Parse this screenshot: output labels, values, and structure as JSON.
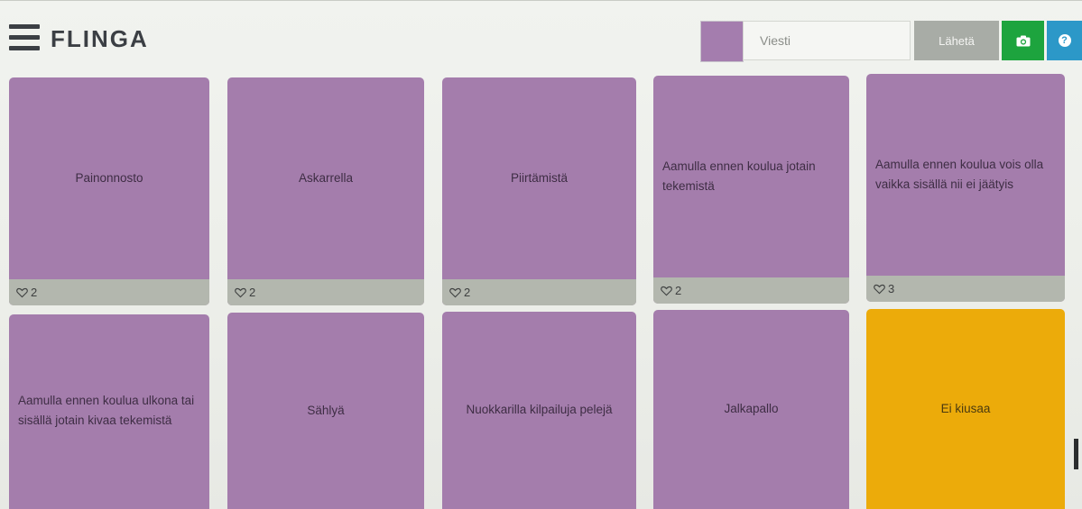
{
  "header": {
    "brand": "FLINGA",
    "swatch_color": "#a47dae",
    "message_placeholder": "Viesti",
    "send_label": "Lähetä",
    "camera_icon": "camera-icon",
    "help_icon": "help-icon",
    "help_glyph": "?"
  },
  "colors": {
    "card_purple": "#a47dac",
    "card_yellow": "#ecab0a",
    "footer_gray": "#b3b7ae",
    "camera_green": "#1da43e",
    "help_blue": "#2c98c8"
  },
  "cards": [
    {
      "text": "Painonnosto",
      "likes": "2"
    },
    {
      "text": "Askarrella",
      "likes": "2"
    },
    {
      "text": "Piirtämistä",
      "likes": "2"
    },
    {
      "text": "Aamulla ennen koulua jotain tekemistä",
      "likes": "2"
    },
    {
      "text": "Aamulla ennen koulua vois olla vaikka sisällä nii ei jäätyis",
      "likes": "3"
    },
    {
      "text": "Aamulla ennen koulua ulkona tai sisällä jotain kivaa tekemistä"
    },
    {
      "text": "Sählyä"
    },
    {
      "text": "Nuokkarilla kilpailuja pelejä"
    },
    {
      "text": "Jalkapallo"
    },
    {
      "text": "Ei kiusaa",
      "color": "yellow"
    }
  ]
}
